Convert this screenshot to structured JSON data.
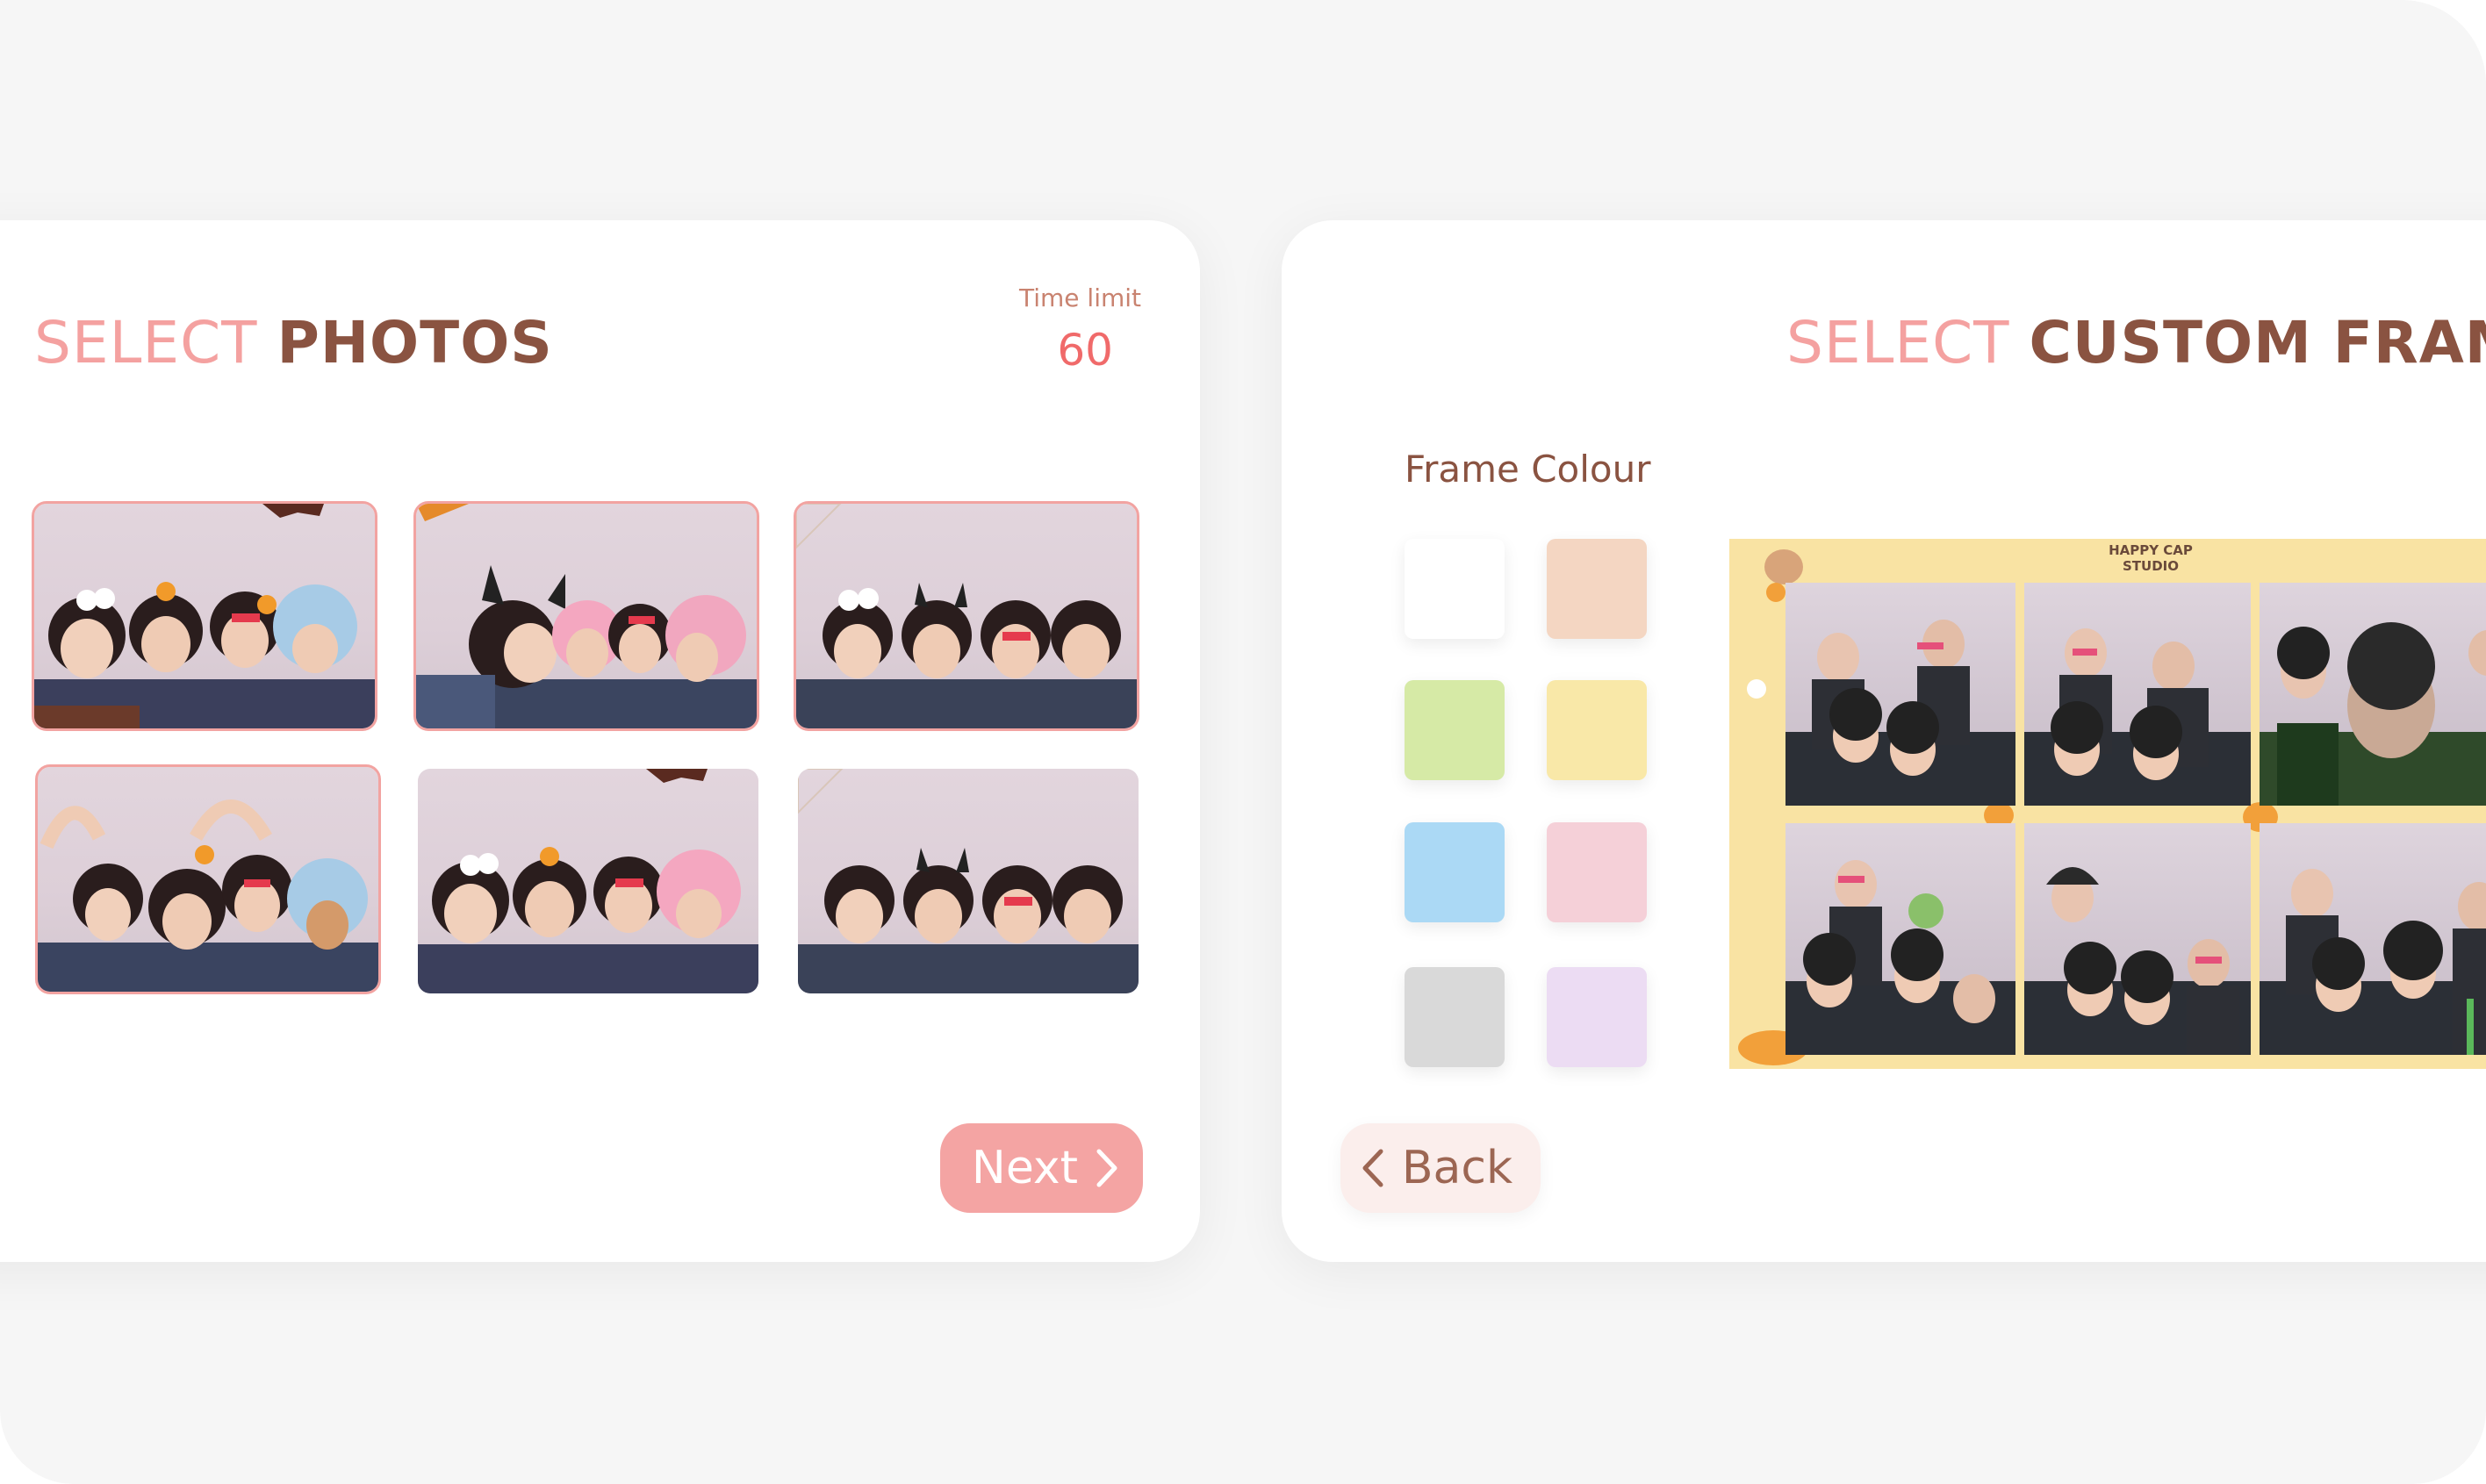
{
  "select_photos": {
    "title_light": "SELECT",
    "title_bold": "PHOTOS",
    "time_limit_label": "Time limit",
    "time_limit_value": "60",
    "next_label": "Next",
    "photos": [
      {
        "description": "group photo with heart hands",
        "selected": true
      },
      {
        "description": "group photo with devil horns",
        "selected": true
      },
      {
        "description": "group photo with hands on cheeks",
        "selected": true
      },
      {
        "description": "group photo with heart arms",
        "selected": true
      },
      {
        "description": "group photo with heart hands",
        "selected": false
      },
      {
        "description": "group photo with hands on cheeks",
        "selected": false
      }
    ]
  },
  "select_frame": {
    "title_light": "SELECT",
    "title_bold": "CUSTOM FRAME",
    "frame_colour_label": "Frame Colour",
    "back_label": "Back",
    "swatches": [
      {
        "name": "white",
        "color": "#ffffff"
      },
      {
        "name": "peach",
        "color": "#f4d6c2"
      },
      {
        "name": "green",
        "color": "#d6eaa6"
      },
      {
        "name": "yellow",
        "color": "#f9e8a8"
      },
      {
        "name": "blue",
        "color": "#abd9f5"
      },
      {
        "name": "pink",
        "color": "#f5d0d8"
      },
      {
        "name": "grey",
        "color": "#d9d9d9"
      },
      {
        "name": "lavender",
        "color": "#ecdcf3"
      }
    ],
    "frame_logo_line1": "HAPPY CAP",
    "frame_logo_line2": "STUDIO"
  },
  "colors": {
    "accent_pink": "#f4a4a3",
    "title_brown": "#8a5341",
    "time_red": "#f06a6a"
  }
}
